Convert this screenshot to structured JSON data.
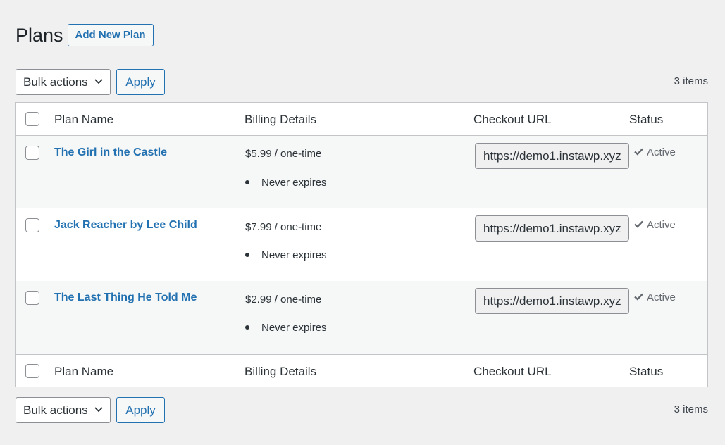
{
  "page": {
    "title": "Plans",
    "add_new_label": "Add New Plan"
  },
  "tablenav_top": {
    "bulk_actions_label": "Bulk actions",
    "apply_label": "Apply",
    "items_count": "3 items"
  },
  "tablenav_bottom": {
    "bulk_actions_label": "Bulk actions",
    "apply_label": "Apply",
    "items_count": "3 items"
  },
  "columns": {
    "plan_name": "Plan Name",
    "billing_details": "Billing Details",
    "checkout_url": "Checkout URL",
    "status": "Status"
  },
  "rows": [
    {
      "plan_name": "The Girl in the Castle",
      "price": "$5.99 / one-time",
      "expiry": "Never expires",
      "checkout_url": "https://demo1.instawp.xyz",
      "status": "Active"
    },
    {
      "plan_name": "Jack Reacher by Lee Child",
      "price": "$7.99 / one-time",
      "expiry": "Never expires",
      "checkout_url": "https://demo1.instawp.xyz",
      "status": "Active"
    },
    {
      "plan_name": "The Last Thing He Told Me",
      "price": "$2.99 / one-time",
      "expiry": "Never expires",
      "checkout_url": "https://demo1.instawp.xyz",
      "status": "Active"
    }
  ],
  "colors": {
    "accent": "#2271b1",
    "background": "#f0f0f1",
    "row_alt": "#f6f7f7"
  }
}
